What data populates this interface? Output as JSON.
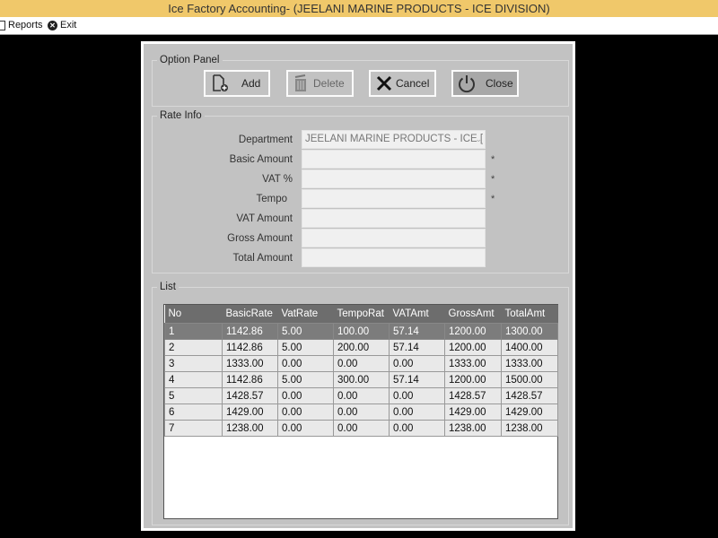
{
  "window": {
    "title": "Ice Factory Accounting- (JEELANI MARINE PRODUCTS - ICE DIVISION)"
  },
  "menu": {
    "items": [
      {
        "label": "Reports",
        "icon": "report-icon"
      },
      {
        "label": "Exit",
        "icon": "exit-icon"
      }
    ]
  },
  "option_panel": {
    "title": "Option Panel",
    "buttons": {
      "add": {
        "label": "Add",
        "icon": "add-file-icon"
      },
      "delete": {
        "label": "Delete",
        "icon": "trash-icon",
        "enabled": false
      },
      "cancel": {
        "label": "Cancel",
        "icon": "x-icon"
      },
      "close": {
        "label": "Close",
        "icon": "power-icon"
      }
    }
  },
  "rate_info": {
    "title": "Rate Info",
    "fields": {
      "department": {
        "label": "Department",
        "value": "JEELANI MARINE PRODUCTS - ICE DIVISION",
        "display_value": "JEELANI MARINE PRODUCTS - ICE [",
        "required": false
      },
      "basic_amount": {
        "label": "Basic Amount",
        "value": "",
        "required": true
      },
      "vat_percent": {
        "label": "VAT %",
        "value": "",
        "required": true
      },
      "tempo": {
        "label": "Tempo",
        "value": "",
        "required": true
      },
      "vat_amount": {
        "label": "VAT Amount",
        "value": ""
      },
      "gross_amount": {
        "label": "Gross Amount",
        "value": ""
      },
      "total_amount": {
        "label": "Total Amount",
        "value": ""
      }
    },
    "required_marker": "*"
  },
  "list": {
    "title": "List",
    "columns": [
      "No",
      "BasicRate",
      "VatRate",
      "TempoRat",
      "VATAmt",
      "GrossAmt",
      "TotalAmt"
    ],
    "selected_row": 0,
    "rows": [
      [
        "1",
        "1142.86",
        "5.00",
        "100.00",
        "57.14",
        "1200.00",
        "1300.00"
      ],
      [
        "2",
        "1142.86",
        "5.00",
        "200.00",
        "57.14",
        "1200.00",
        "1400.00"
      ],
      [
        "3",
        "1333.00",
        "0.00",
        "0.00",
        "0.00",
        "1333.00",
        "1333.00"
      ],
      [
        "4",
        "1142.86",
        "5.00",
        "300.00",
        "57.14",
        "1200.00",
        "1500.00"
      ],
      [
        "5",
        "1428.57",
        "0.00",
        "0.00",
        "0.00",
        "1428.57",
        "1428.57"
      ],
      [
        "6",
        "1429.00",
        "0.00",
        "0.00",
        "0.00",
        "1429.00",
        "1429.00"
      ],
      [
        "7",
        "1238.00",
        "0.00",
        "0.00",
        "0.00",
        "1238.00",
        "1238.00"
      ]
    ]
  },
  "colors": {
    "titlebar": "#f0c86a",
    "panel": "#c2c2c2",
    "grid_header": "#6d6d6d",
    "selected_row": "#7c7c7c"
  }
}
